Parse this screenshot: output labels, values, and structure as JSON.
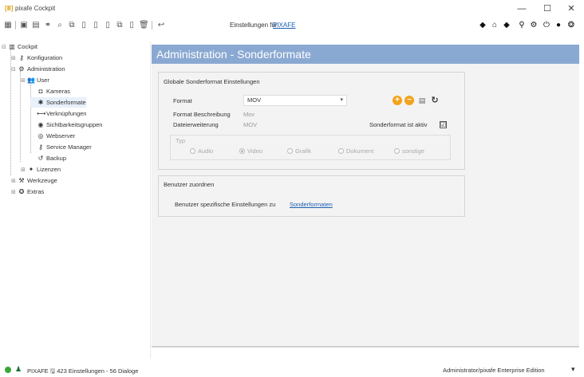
{
  "window": {
    "title": "pixafe Cockpit",
    "minimize": "—",
    "maximize": "☐",
    "close": "✕"
  },
  "toolbar": {
    "settings_label": "Einstellungen für",
    "settings_link": "PIXAFE"
  },
  "tree": {
    "items": [
      {
        "label": "Cockpit",
        "icon": "cockpit-icon",
        "glyph": "▥",
        "exp": "⊟"
      },
      {
        "label": "Konfiguration",
        "icon": "key-icon",
        "glyph": "⚷",
        "exp": "⊞"
      },
      {
        "label": "Administration",
        "icon": "admin-icon",
        "glyph": "⚙",
        "exp": "⊟"
      },
      {
        "label": "User",
        "icon": "users-icon",
        "glyph": "👥",
        "exp": "⊞"
      },
      {
        "label": "Kameras",
        "icon": "camera-icon",
        "glyph": "◘",
        "exp": ""
      },
      {
        "label": "Sonderformate",
        "icon": "special-formats-icon",
        "glyph": "✱",
        "exp": ""
      },
      {
        "label": "Verknüpfungen",
        "icon": "link-icon",
        "glyph": "⟷",
        "exp": ""
      },
      {
        "label": "Sichtbarkeitsgruppen",
        "icon": "visibility-icon",
        "glyph": "◉",
        "exp": ""
      },
      {
        "label": "Webserver",
        "icon": "webserver-icon",
        "glyph": "◎",
        "exp": ""
      },
      {
        "label": "Service Manager",
        "icon": "service-manager-icon",
        "glyph": "⚷",
        "exp": ""
      },
      {
        "label": "Backup",
        "icon": "backup-icon",
        "glyph": "↺",
        "exp": ""
      },
      {
        "label": "Lizenzen",
        "icon": "license-icon",
        "glyph": "✦",
        "exp": "⊞"
      },
      {
        "label": "Werkzeuge",
        "icon": "tools-icon",
        "glyph": "⚒",
        "exp": "⊞"
      },
      {
        "label": "Extras",
        "icon": "extras-icon",
        "glyph": "✪",
        "exp": "⊞"
      }
    ]
  },
  "header": {
    "title": "Administration - Sonderformate"
  },
  "global_settings": {
    "group_label": "Globale Sonderformat Einstellungen",
    "format_label": "Format",
    "format_value": "MOV",
    "description_label": "Format Beschreibung",
    "description_value": "Mov",
    "extension_label": "Dateierweiterung",
    "extension_value": "MOV",
    "active_label": "Sonderformat ist aktiv",
    "active_checked": "☑",
    "type_label": "Typ",
    "types": [
      {
        "label": "Audio",
        "checked": false
      },
      {
        "label": "Video",
        "checked": true
      },
      {
        "label": "Grafik",
        "checked": false
      },
      {
        "label": "Dokument",
        "checked": false
      },
      {
        "label": "sonstige",
        "checked": false
      }
    ]
  },
  "users": {
    "group_label": "Benutzer zuordnen",
    "text": "Benutzer spezifische Einstellungen zu",
    "link": "Sonderformaten"
  },
  "status": {
    "left": "PIXAFE 🖫 423 Einstellungen - 56 Dialoge",
    "right": "Administrator/pixafe Enterprise Edition"
  },
  "colors": {
    "header_band": "#8aa9d2",
    "accent_orange": "#f2a31c",
    "link": "#1a5fb4"
  }
}
